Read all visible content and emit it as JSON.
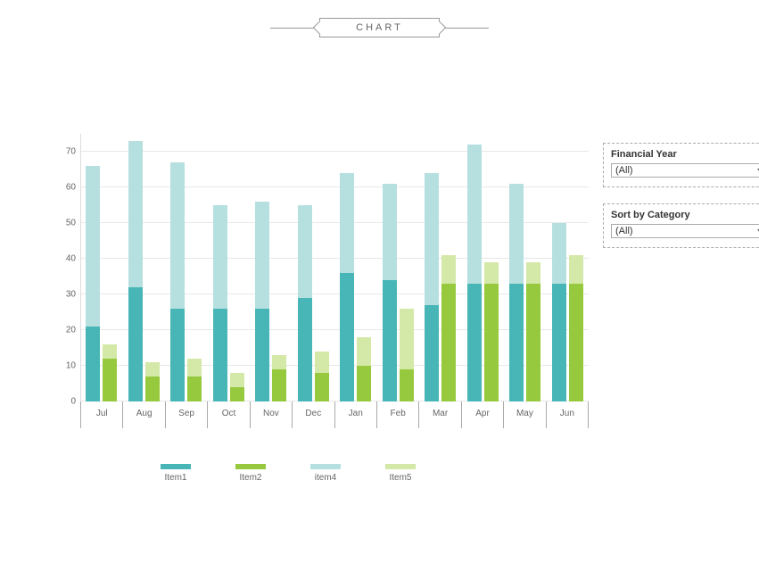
{
  "header": {
    "title": "CHART"
  },
  "legend": {
    "items": [
      {
        "label": "Item1",
        "color": "#48b6b6"
      },
      {
        "label": "Item2",
        "color": "#96c93d"
      },
      {
        "label": "item4",
        "color": "#b6e0e0"
      },
      {
        "label": "Item5",
        "color": "#d4e8a8"
      }
    ]
  },
  "controls": {
    "financial_year": {
      "label": "Financial Year",
      "value": "(All)"
    },
    "sort_category": {
      "label": "Sort by Category",
      "value": "(All)"
    }
  },
  "chart_data": {
    "type": "bar",
    "stacked_groups": [
      {
        "stack": [
          "Item1",
          "item4"
        ]
      },
      {
        "stack": [
          "Item2",
          "Item5"
        ]
      }
    ],
    "categories": [
      "Jul",
      "Aug",
      "Sep",
      "Oct",
      "Nov",
      "Dec",
      "Jan",
      "Feb",
      "Mar",
      "Apr",
      "May",
      "Jun"
    ],
    "series": [
      {
        "name": "Item1",
        "values": [
          21,
          32,
          26,
          26,
          26,
          29,
          36,
          34,
          27,
          33,
          33,
          33
        ]
      },
      {
        "name": "item4",
        "values": [
          45,
          41,
          41,
          29,
          30,
          26,
          28,
          27,
          37,
          39,
          28,
          17
        ]
      },
      {
        "name": "Item2",
        "values": [
          12,
          7,
          7,
          4,
          9,
          8,
          10,
          9,
          33,
          33,
          33,
          33
        ]
      },
      {
        "name": "Item5",
        "values": [
          4,
          4,
          5,
          4,
          4,
          6,
          8,
          17,
          8,
          6,
          6,
          8
        ]
      }
    ],
    "ylabel": "",
    "xlabel": "",
    "ylim": [
      0,
      75
    ],
    "yticks": [
      0,
      10,
      20,
      30,
      40,
      50,
      60,
      70
    ],
    "title": ""
  }
}
